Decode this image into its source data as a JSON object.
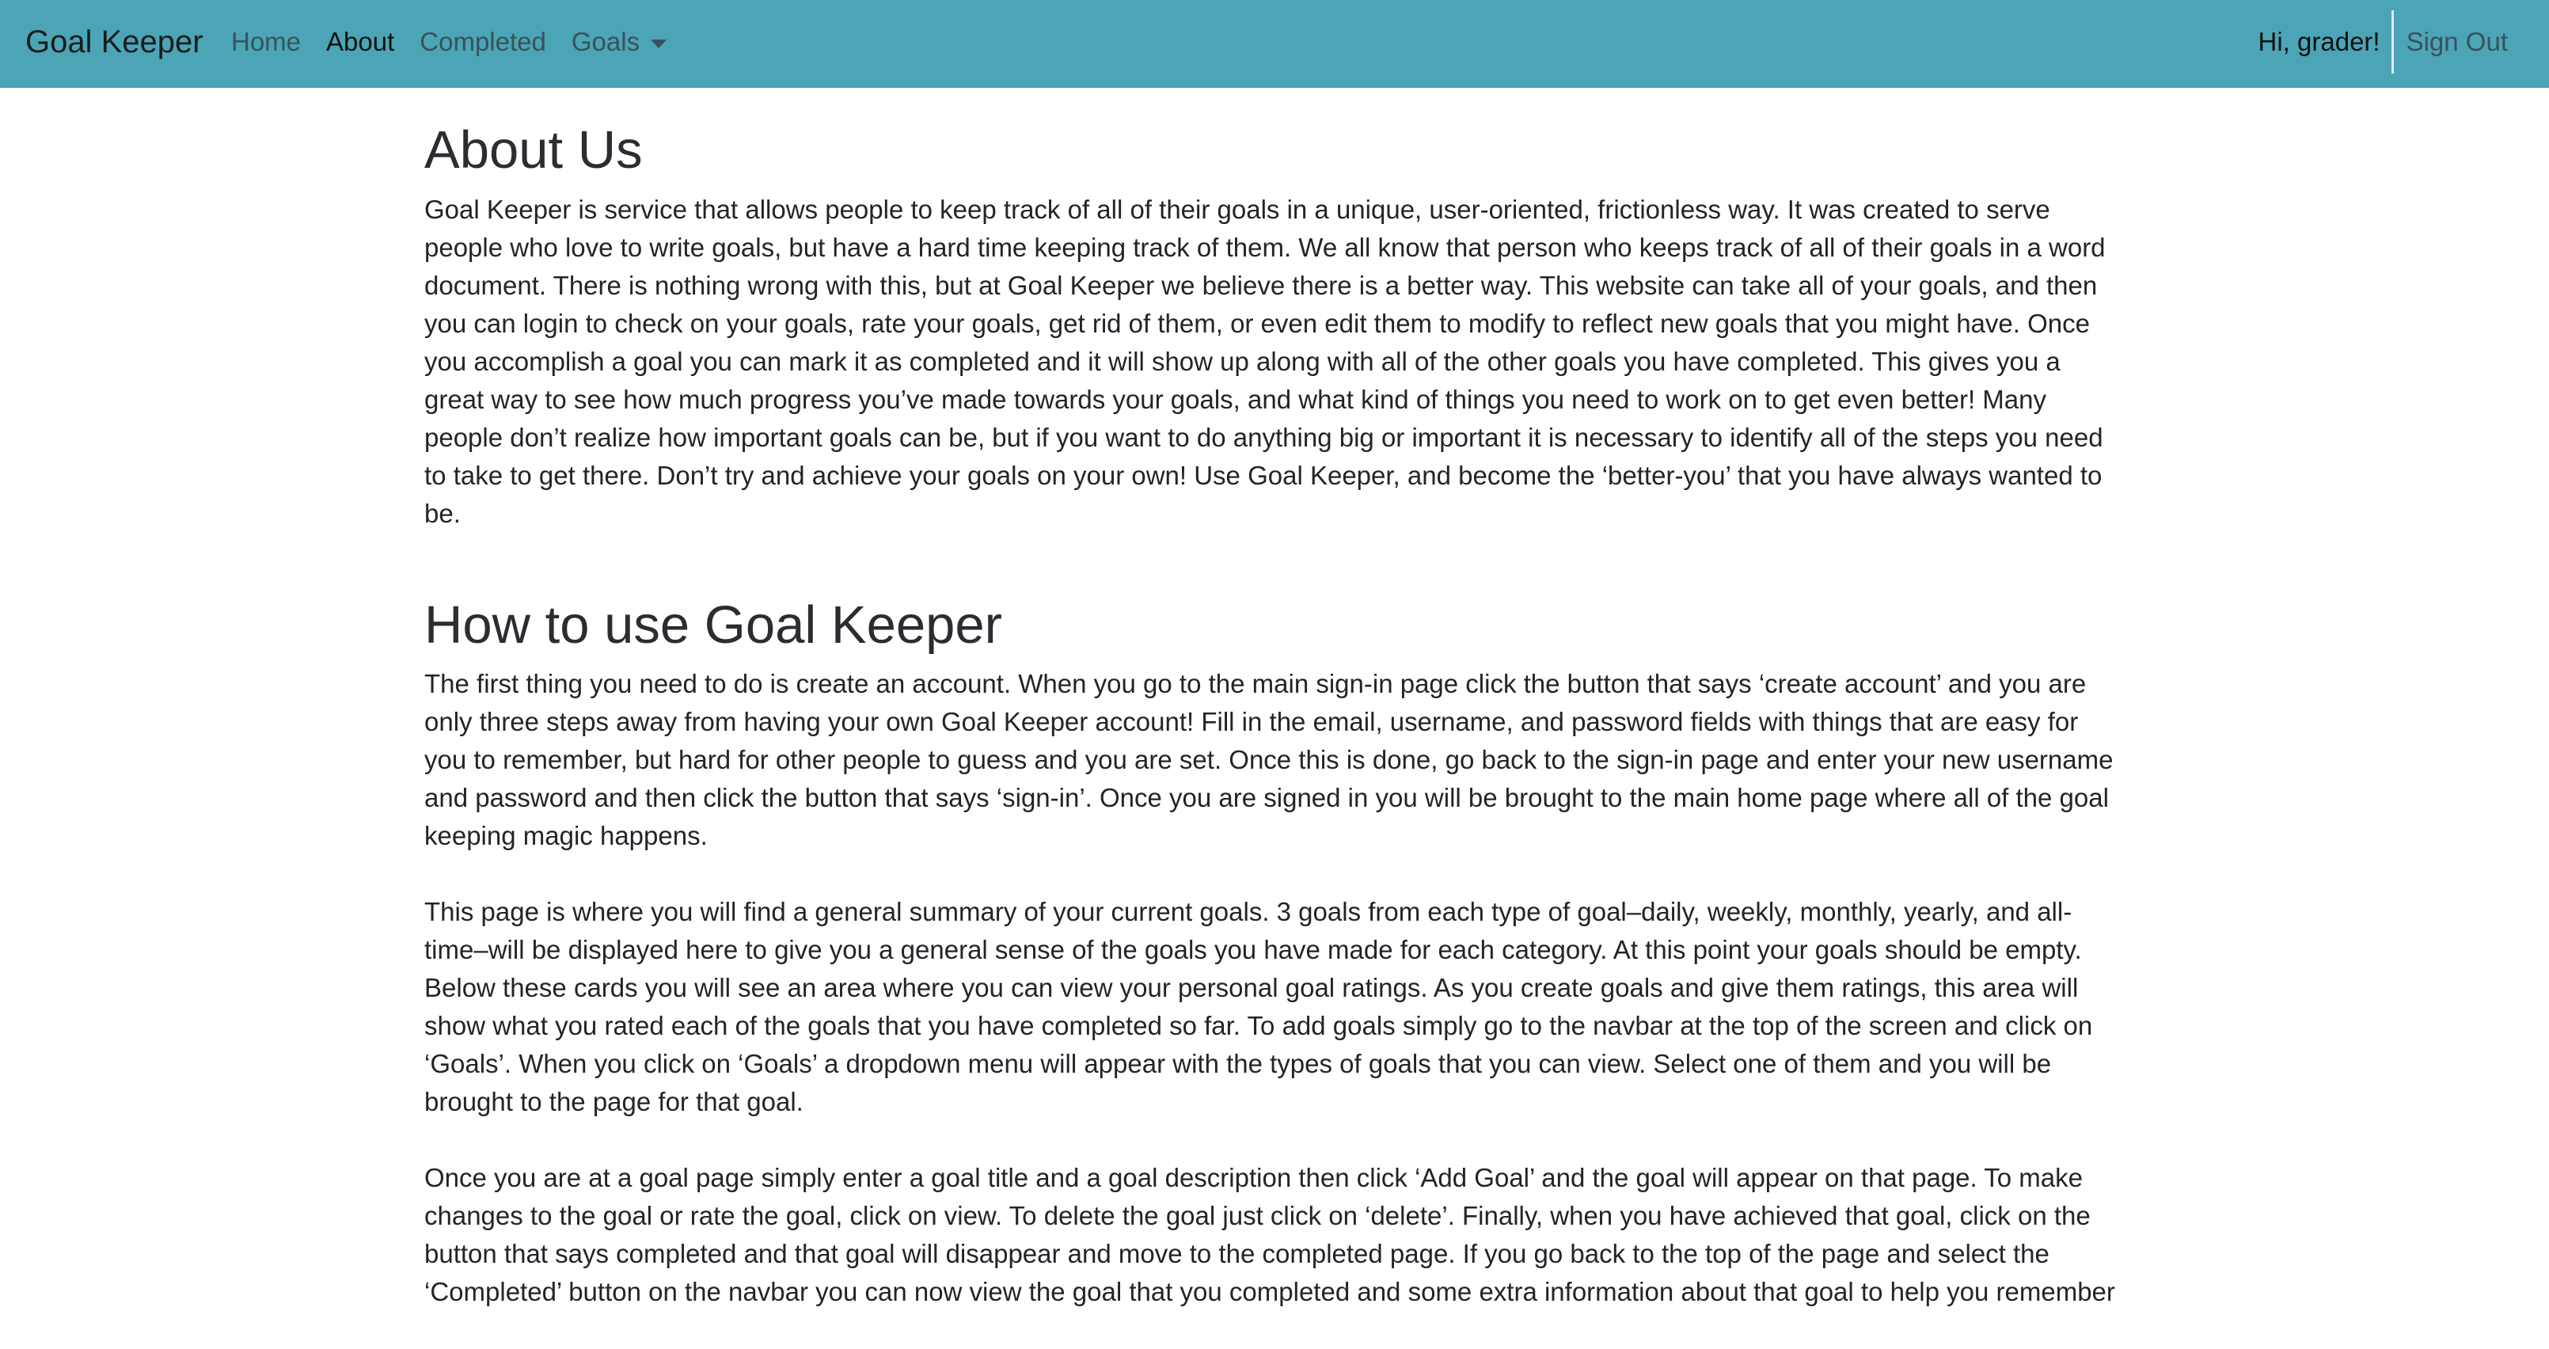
{
  "navbar": {
    "brand": "Goal Keeper",
    "links": [
      {
        "label": "Home"
      },
      {
        "label": "About"
      },
      {
        "label": "Completed"
      },
      {
        "label": "Goals"
      }
    ],
    "greeting": "Hi, grader!",
    "sign_out": "Sign Out"
  },
  "about": {
    "title": "About Us",
    "body": "Goal Keeper is service that allows people to keep track of all of their goals in a unique, user-oriented, frictionless way. It was created to serve people who love to write goals, but have a hard time keeping track of them. We all know that person who keeps track of all of their goals in a word document. There is nothing wrong with this, but at Goal Keeper we believe there is a better way. This website can take all of your goals, and then you can login to check on your goals, rate your goals, get rid of them, or even edit them to modify to reflect new goals that you might have. Once you accomplish a goal you can mark it as completed and it will show up along with all of the other goals you have completed. This gives you a great way to see how much progress you’ve made towards your goals, and what kind of things you need to work on to get even better! Many people don’t realize how important goals can be, but if you want to do anything big or important it is necessary to identify all of the steps you need to take to get there. Don’t try and achieve your goals on your own! Use Goal Keeper, and become the ‘better-you’ that you have always wanted to be."
  },
  "howto": {
    "title": "How to use Goal Keeper",
    "paragraphs": [
      "The first thing you need to do is create an account. When you go to the main sign-in page click the button that says ‘create account’ and you are only three steps away from having your own Goal Keeper account! Fill in the email, username, and password fields with things that are easy for you to remember, but hard for other people to guess and you are set. Once this is done, go back to the sign-in page and enter your new username and password and then click the button that says ‘sign-in’. Once you are signed in you will be brought to the main home page where all of the goal keeping magic happens.",
      "This page is where you will find a general summary of your current goals. 3 goals from each type of goal–daily, weekly, monthly, yearly, and all-time–will be displayed here to give you a general sense of the goals you have made for each category. At this point your goals should be empty. Below these cards you will see an area where you can view your personal goal ratings. As you create goals and give them ratings, this area will show what you rated each of the goals that you have completed so far. To add goals simply go to the navbar at the top of the screen and click on ‘Goals’. When you click on ‘Goals’ a dropdown menu will appear with the types of goals that you can view. Select one of them and you will be brought to the page for that goal.",
      "Once you are at a goal page simply enter a goal title and a goal description then click ‘Add Goal’ and the goal will appear on that page. To make changes to the goal or rate the goal, click on view. To delete the goal just click on ‘delete’. Finally, when you have achieved that goal, click on the button that says completed and that goal will disappear and move to the completed page. If you go back to the top of the page and select the ‘Completed’ button on the navbar you can now view the goal that you completed and some extra information about that goal to help you remember"
    ]
  },
  "colors": {
    "navbar_bg": "#4ba5b6",
    "active_link": "#111111",
    "inactive_link": "#39525a"
  }
}
